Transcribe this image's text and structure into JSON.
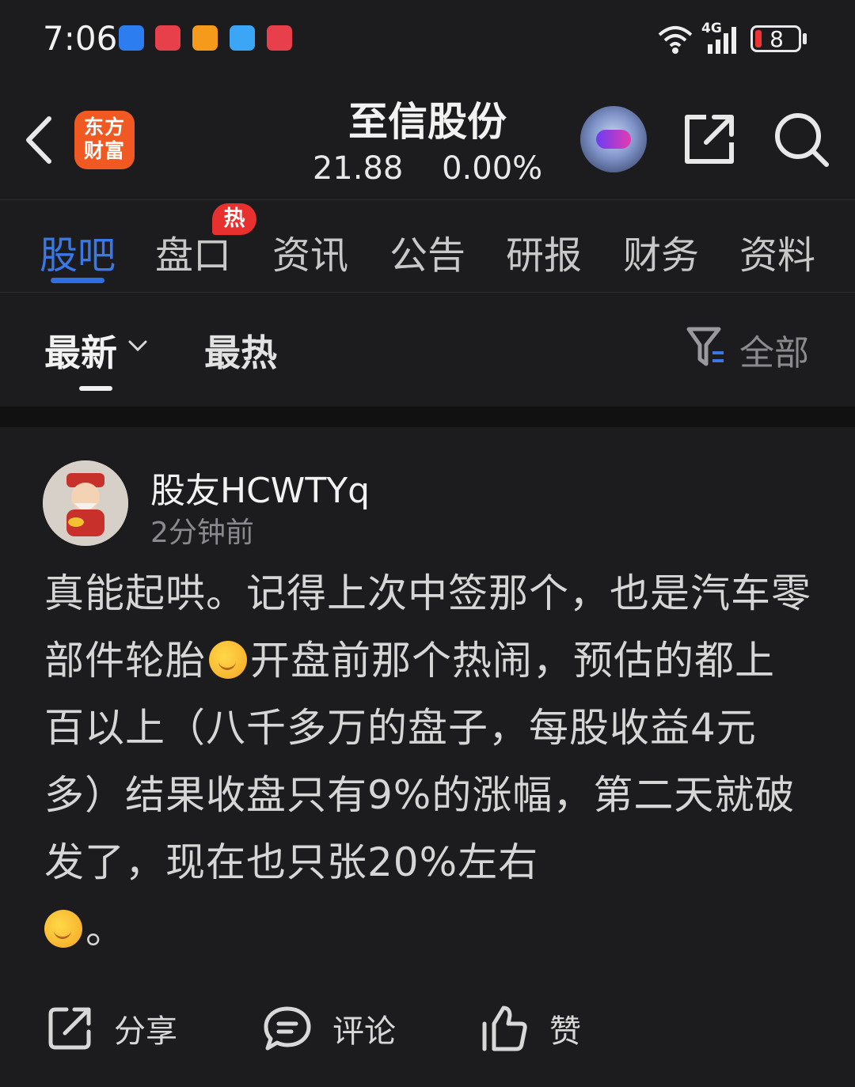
{
  "status_bar": {
    "time": "7:06",
    "network": "4G",
    "battery": "8"
  },
  "header": {
    "logo_line1": "东方",
    "logo_line2": "财富",
    "stock_name": "至信股份",
    "price": "21.88",
    "change": "0.00%"
  },
  "tabs": [
    {
      "label": "股吧"
    },
    {
      "label": "盘口"
    },
    {
      "label": "资讯"
    },
    {
      "label": "公告"
    },
    {
      "label": "研报"
    },
    {
      "label": "财务"
    },
    {
      "label": "资料"
    }
  ],
  "hot_badge": "热",
  "filter": {
    "sort_latest": "最新",
    "sort_hot": "最热",
    "scope": "全部"
  },
  "post": {
    "username": "股友HCWTYq",
    "time": "2分钟前",
    "text_part1": "真能起哄。记得上次中签那个，也是汽车零部件轮胎",
    "text_part2": "开盘前那个热闹，预估的都上百以上（八千多万的盘子，每股收益4元多）结果收盘只有9%的涨幅，第二天就破发了，现在也只张20%左右",
    "text_part3": "。",
    "actions": {
      "share": "分享",
      "comment": "评论",
      "like": "赞"
    }
  },
  "colors": {
    "accent": "#2f6fe4",
    "brand": "#f05a22",
    "badge": "#e8302f",
    "background": "#1c1c1e"
  }
}
